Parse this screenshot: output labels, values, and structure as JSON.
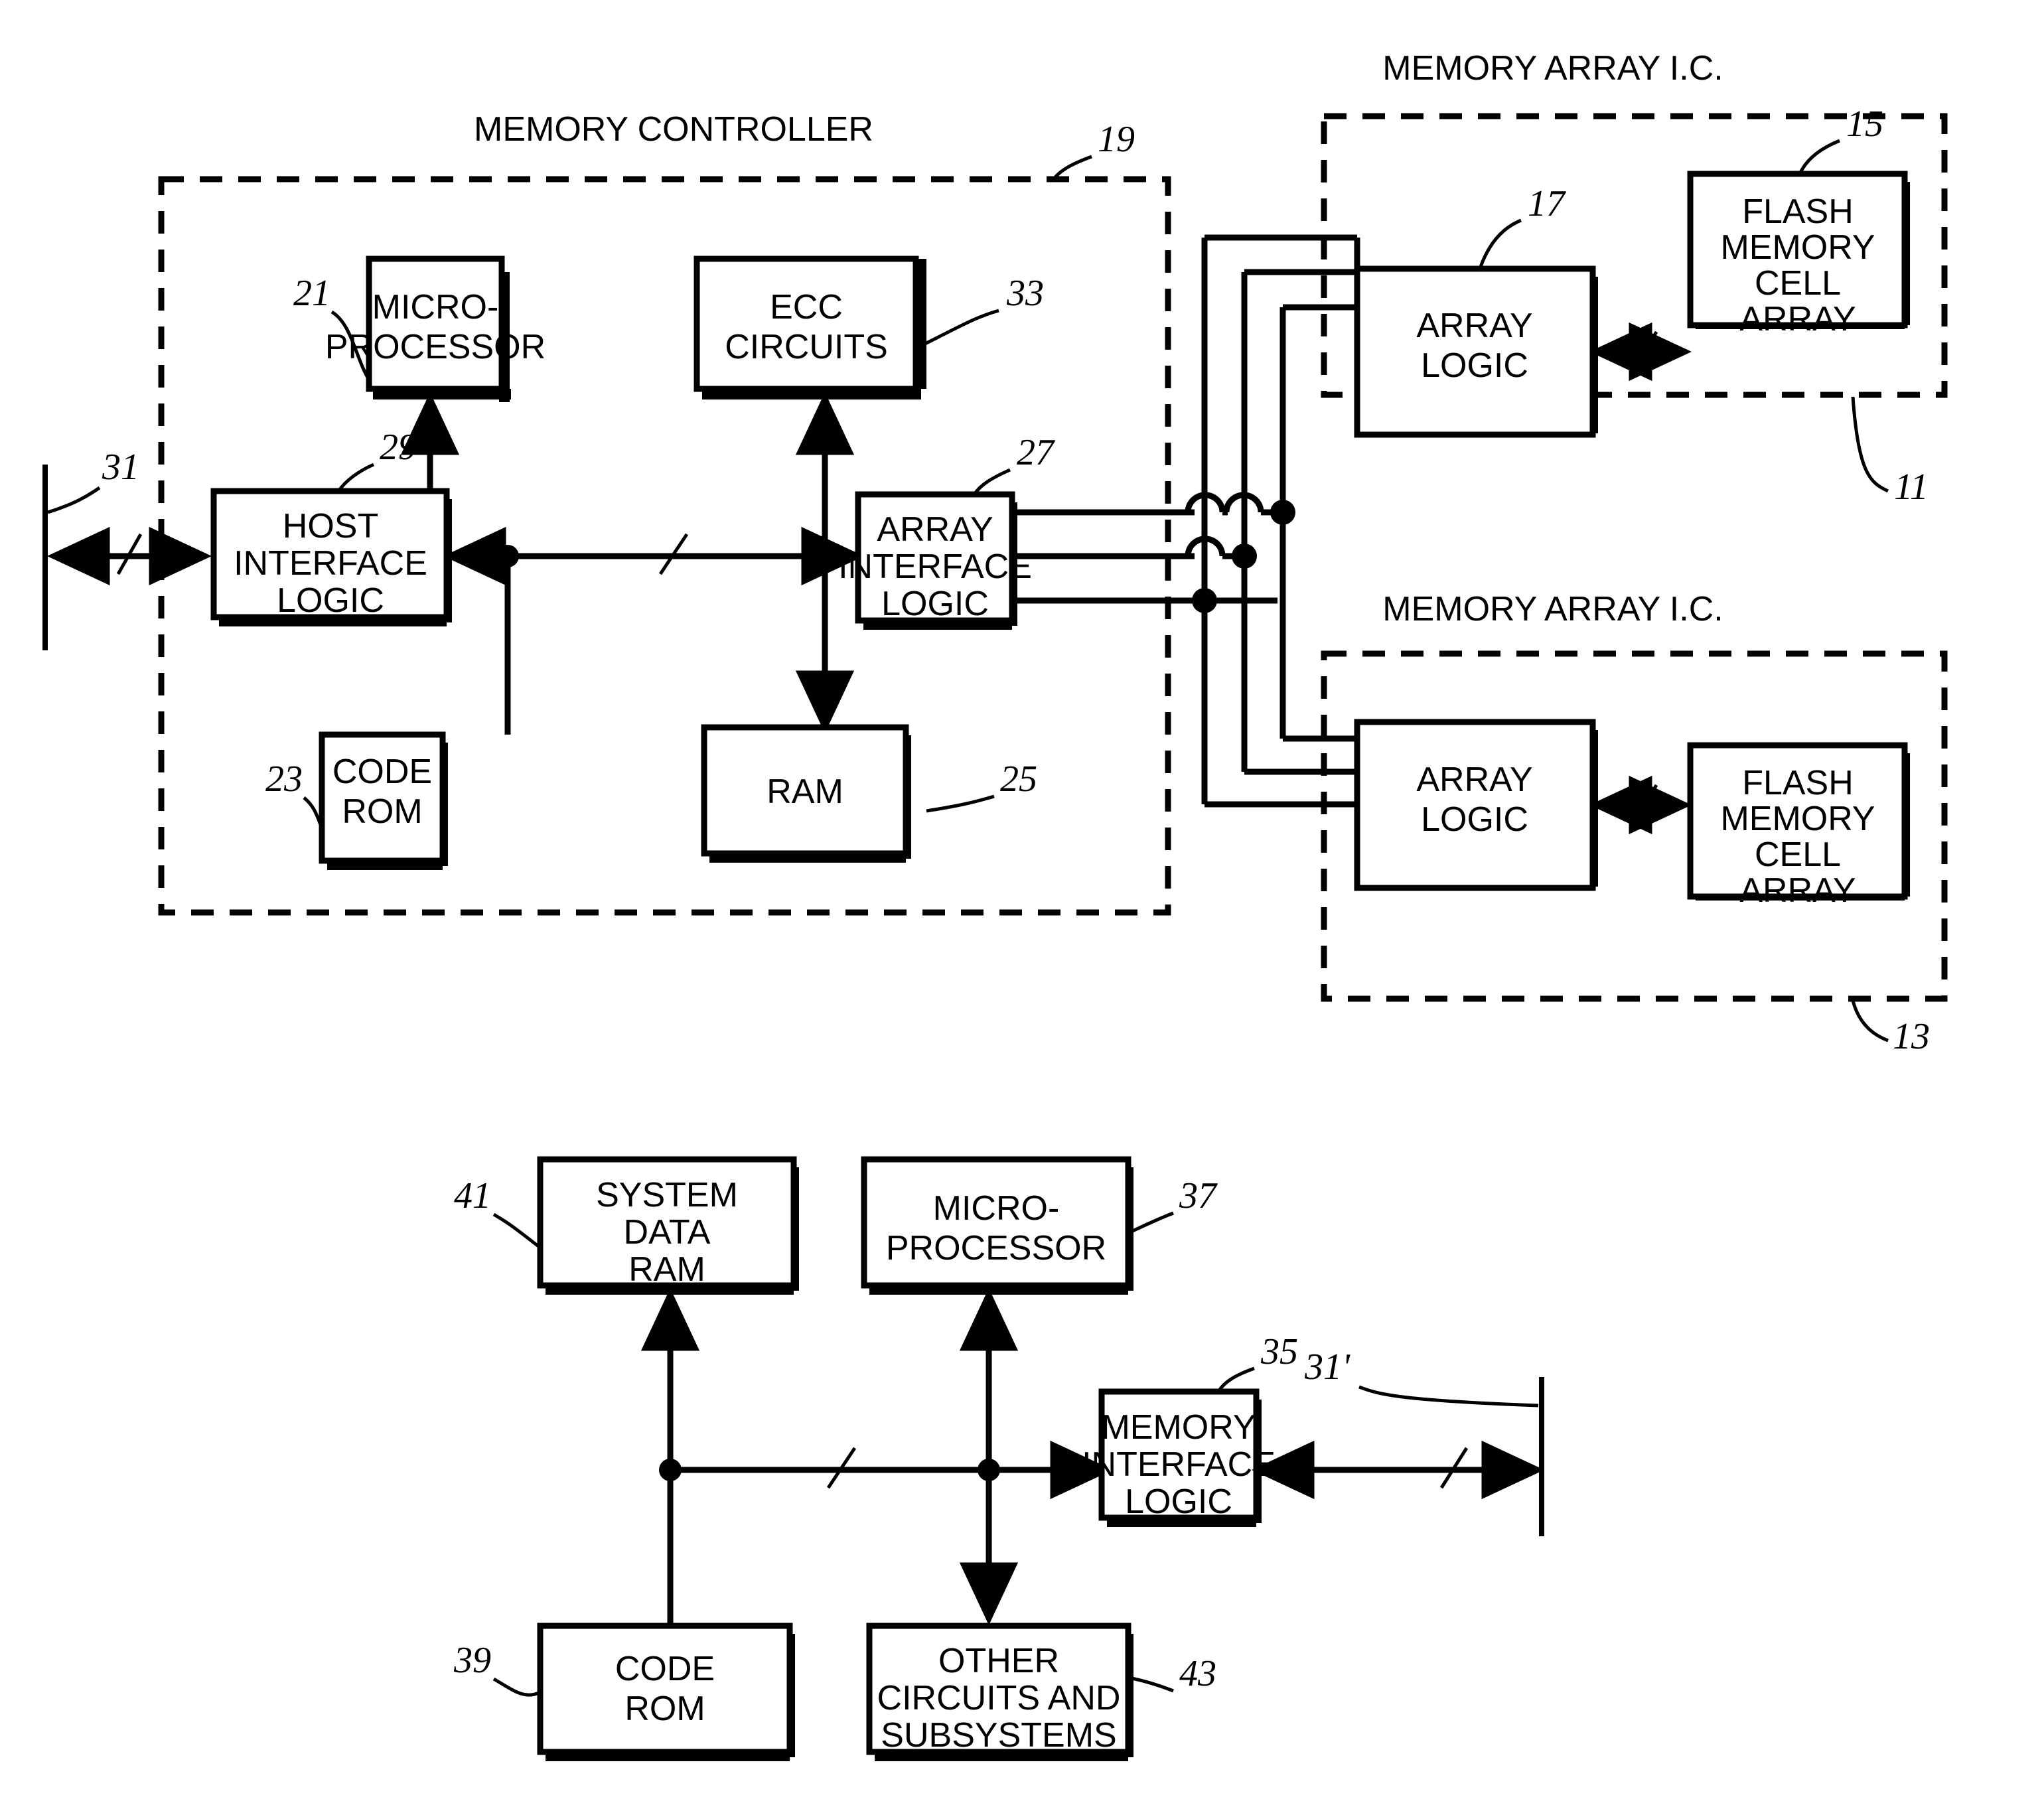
{
  "figure": {
    "domain": "patent-block-diagram",
    "titles": {
      "memory_controller": "MEMORY CONTROLLER",
      "memory_array_ic_top": "MEMORY ARRAY I.C.",
      "memory_array_ic_bottom": "MEMORY ARRAY I.C."
    },
    "top_diagram": {
      "boxes": [
        {
          "id": "microprocessor",
          "lines": [
            "MICRO-",
            "PROCESSOR"
          ],
          "ref": "21"
        },
        {
          "id": "ecc-circuits",
          "lines": [
            "ECC",
            "CIRCUITS"
          ],
          "ref": "33"
        },
        {
          "id": "host-interface-logic",
          "lines": [
            "HOST",
            "INTERFACE",
            "LOGIC"
          ],
          "ref": "29"
        },
        {
          "id": "array-interface-logic",
          "lines": [
            "ARRAY",
            "INTERFACE",
            "LOGIC"
          ],
          "ref": "27"
        },
        {
          "id": "code-rom",
          "lines": [
            "CODE",
            "ROM"
          ],
          "ref": "23"
        },
        {
          "id": "ram",
          "lines": [
            "RAM"
          ],
          "ref": "25"
        },
        {
          "id": "array-logic-top",
          "lines": [
            "ARRAY",
            "LOGIC"
          ],
          "ref": "17"
        },
        {
          "id": "flash-memory-cell-array-top",
          "lines": [
            "FLASH",
            "MEMORY",
            "CELL",
            "ARRAY"
          ],
          "ref": "15"
        },
        {
          "id": "array-logic-bottom",
          "lines": [
            "ARRAY",
            "LOGIC"
          ],
          "ref": ""
        },
        {
          "id": "flash-memory-cell-array-bottom",
          "lines": [
            "FLASH",
            "MEMORY",
            "CELL",
            "ARRAY"
          ],
          "ref": ""
        }
      ],
      "refs": {
        "controller_boundary": "19",
        "host_bus": "31",
        "array_ic_top": "11",
        "array_ic_bottom": "13"
      }
    },
    "bottom_diagram": {
      "boxes": [
        {
          "id": "system-data-ram",
          "lines": [
            "SYSTEM",
            "DATA",
            "RAM"
          ],
          "ref": "41"
        },
        {
          "id": "microprocessor-host",
          "lines": [
            "MICRO-",
            "PROCESSOR"
          ],
          "ref": "37"
        },
        {
          "id": "memory-interface-logic",
          "lines": [
            "MEMORY",
            "INTERFACE",
            "LOGIC"
          ],
          "ref": "35"
        },
        {
          "id": "code-rom-host",
          "lines": [
            "CODE",
            "ROM"
          ],
          "ref": "39"
        },
        {
          "id": "other-circuits",
          "lines": [
            "OTHER",
            "CIRCUITS AND",
            "SUBSYSTEMS"
          ],
          "ref": "43"
        }
      ],
      "refs": {
        "host_bus": "31'"
      }
    },
    "labels": {
      "micro_l1": "MICRO-",
      "micro_l2": "PROCESSOR",
      "ecc_l1": "ECC",
      "ecc_l2": "CIRCUITS",
      "host_l1": "HOST",
      "host_l2": "INTERFACE",
      "host_l3": "LOGIC",
      "arrayif_l1": "ARRAY",
      "arrayif_l2": "INTERFACE",
      "arrayif_l3": "LOGIC",
      "coderom_l1": "CODE",
      "coderom_l2": "ROM",
      "ram_l1": "RAM",
      "arraylogic_l1": "ARRAY",
      "arraylogic_l2": "LOGIC",
      "flash_l1": "FLASH",
      "flash_l2": "MEMORY",
      "flash_l3": "CELL",
      "flash_l4": "ARRAY",
      "sysram_l1": "SYSTEM",
      "sysram_l2": "DATA",
      "sysram_l3": "RAM",
      "memif_l1": "MEMORY",
      "memif_l2": "INTERFACE",
      "memif_l3": "LOGIC",
      "other_l1": "OTHER",
      "other_l2": "CIRCUITS AND",
      "other_l3": "SUBSYSTEMS",
      "ref11": "11",
      "ref13": "13",
      "ref15": "15",
      "ref17": "17",
      "ref19": "19",
      "ref21": "21",
      "ref23": "23",
      "ref25": "25",
      "ref27": "27",
      "ref29": "29",
      "ref31": "31",
      "ref33": "33",
      "ref35": "35",
      "ref37": "37",
      "ref39": "39",
      "ref41": "41",
      "ref43": "43",
      "ref31p": "31'"
    }
  }
}
